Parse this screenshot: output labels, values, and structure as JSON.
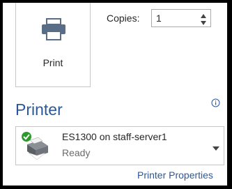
{
  "print": {
    "label": "Print",
    "icon": "printer-icon"
  },
  "copies": {
    "label": "Copies:",
    "value": "1"
  },
  "printer_section": {
    "title": "Printer",
    "info_icon": "info-icon",
    "selected_printer": {
      "name": "ES1300 on staff-server1",
      "status": "Ready",
      "icon": "printer-ready-icon"
    },
    "properties_link": "Printer Properties"
  },
  "colors": {
    "accent": "#2b579a",
    "ready_green": "#2e9a2e"
  }
}
